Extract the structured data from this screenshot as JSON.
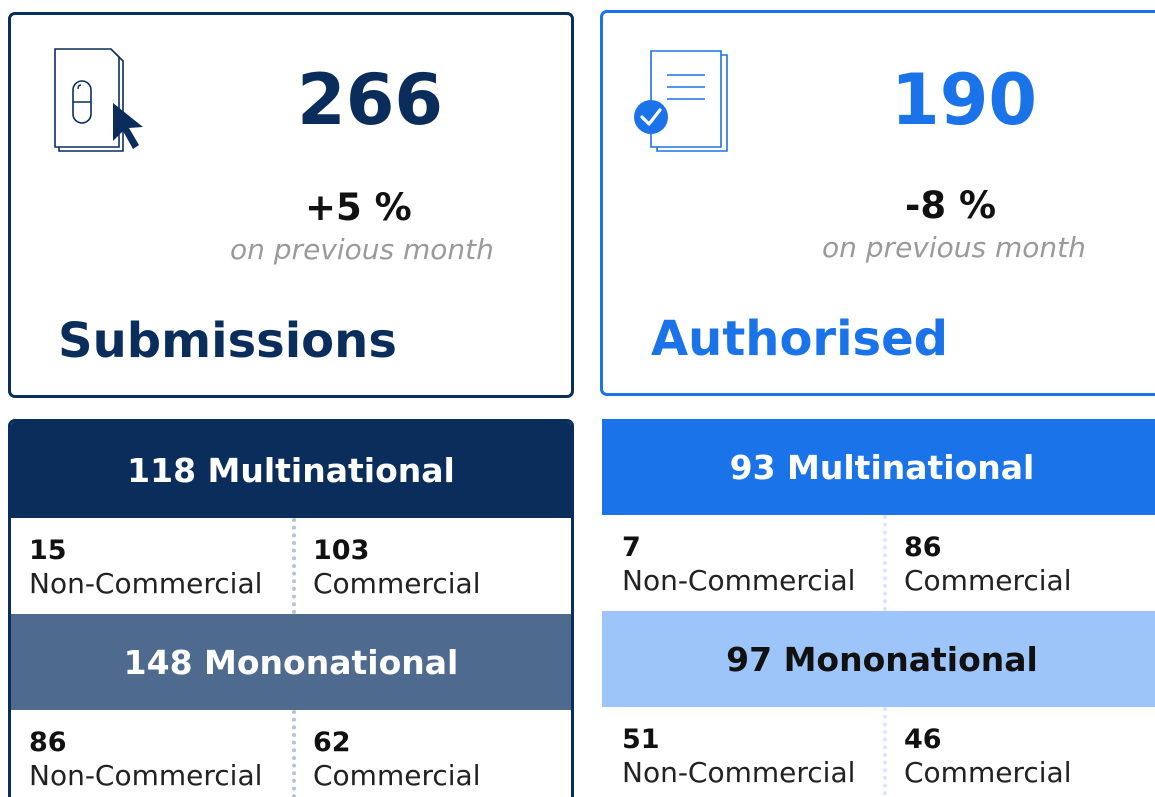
{
  "submissions": {
    "count": "266",
    "change": "+5 %",
    "change_note": "on previous month",
    "title": "Submissions",
    "icon": "document-click-icon",
    "multinational": {
      "label": "118 Multinational",
      "non_commercial": {
        "value": "15",
        "label": "Non-Commercial"
      },
      "commercial": {
        "value": "103",
        "label": "Commercial"
      }
    },
    "mononational": {
      "label": "148 Mononational",
      "non_commercial": {
        "value": "86",
        "label": "Non-Commercial"
      },
      "commercial": {
        "value": "62",
        "label": "Commercial"
      }
    }
  },
  "authorised": {
    "count": "190",
    "change": "-8 %",
    "change_note": "on previous month",
    "title": "Authorised",
    "icon": "document-check-icon",
    "multinational": {
      "label": "93 Multinational",
      "non_commercial": {
        "value": "7",
        "label": "Non-Commercial"
      },
      "commercial": {
        "value": "86",
        "label": "Commercial"
      }
    },
    "mononational": {
      "label": "97 Mononational",
      "non_commercial": {
        "value": "51",
        "label": "Non-Commercial"
      },
      "commercial": {
        "value": "46",
        "label": "Commercial"
      }
    }
  },
  "colors": {
    "navy": "#0a2d5c",
    "navy_muted": "#4e6a8f",
    "blue": "#1a73e8",
    "blue_light": "#9ec5fa",
    "muted_text": "#9a9a9a"
  }
}
